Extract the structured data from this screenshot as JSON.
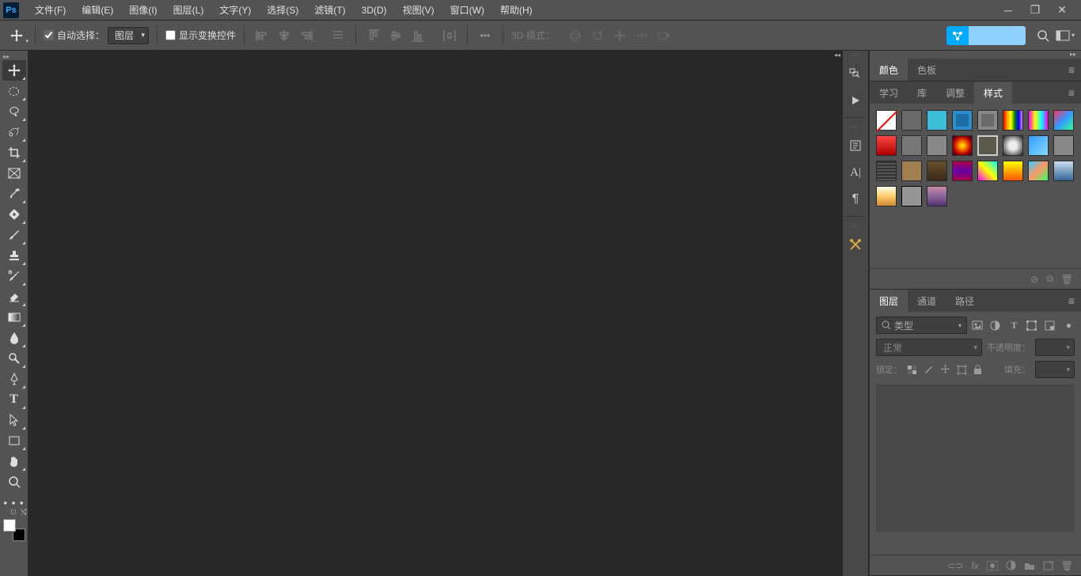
{
  "menu": {
    "file": "文件(F)",
    "edit": "编辑(E)",
    "image": "图像(I)",
    "layer": "图层(L)",
    "type": "文字(Y)",
    "select": "选择(S)",
    "filter": "滤镜(T)",
    "threeD": "3D(D)",
    "view": "视图(V)",
    "window": "窗口(W)",
    "help": "帮助(H)"
  },
  "options": {
    "auto_select_label": "自动选择：",
    "auto_select_checked": true,
    "target_select": "图层",
    "show_transform_label": "显示变换控件",
    "show_transform_checked": false,
    "mode3d_label": "3D 模式："
  },
  "panels": {
    "color_tab": "颜色",
    "swatches_tab": "色板",
    "learn_tab": "学习",
    "library_tab": "库",
    "adjust_tab": "调整",
    "styles_tab": "样式",
    "layers_tab": "图层",
    "channels_tab": "通道",
    "paths_tab": "路径"
  },
  "layers": {
    "kind_placeholder": "类型",
    "blend_mode": "正常",
    "opacity_label": "不透明度：",
    "lock_label": "锁定：",
    "fill_label": "填充："
  }
}
